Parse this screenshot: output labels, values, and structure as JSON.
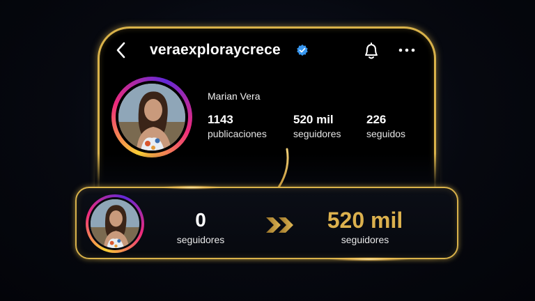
{
  "profile": {
    "username": "veraexploraycrece",
    "display_name": "Marian Vera",
    "stats": [
      {
        "value": "1143",
        "label": "publicaciones"
      },
      {
        "value": "520 mil",
        "label": "seguidores"
      },
      {
        "value": "226",
        "label": "seguidos"
      }
    ]
  },
  "comparison": {
    "from_value": "0",
    "from_label": "seguidores",
    "to_value": "520 mil",
    "to_label": "seguidores"
  },
  "icons": [
    "back-chevron-icon",
    "verified-badge-icon",
    "bell-icon",
    "more-options-icon",
    "curved-arrow-icon",
    "double-chevron-icon"
  ],
  "colors": {
    "gold": "#d9b24a",
    "verified_blue": "#3897f0",
    "background": "#05070d"
  }
}
